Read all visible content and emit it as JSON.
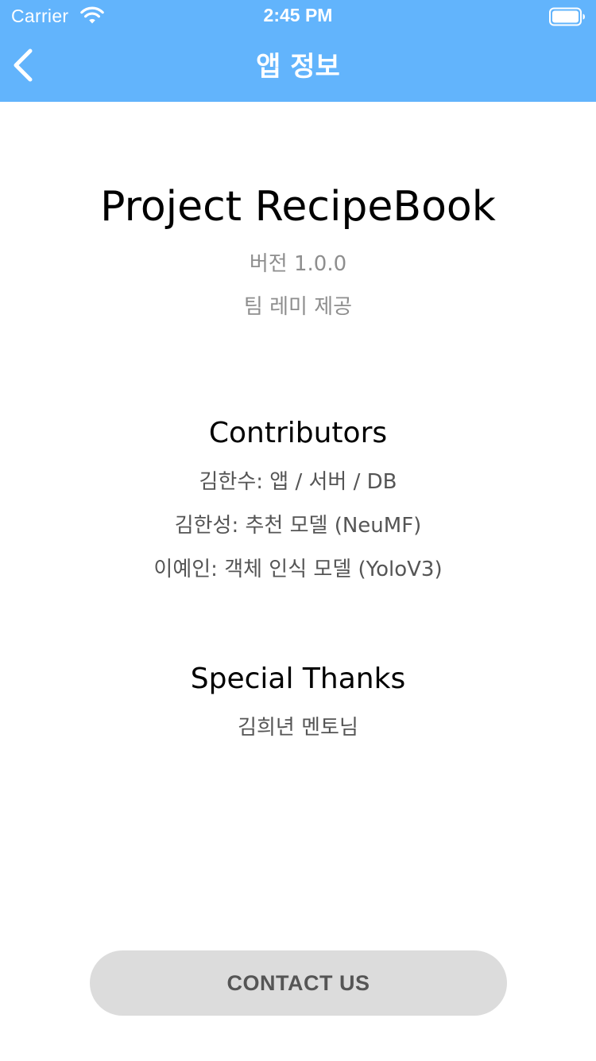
{
  "status_bar": {
    "carrier": "Carrier",
    "time": "2:45 PM",
    "wifi_icon": "wifi-icon",
    "battery_icon": "battery-icon"
  },
  "nav": {
    "title": "앱 정보",
    "back_icon": "chevron-left-icon"
  },
  "app_info": {
    "project_name": "Project RecipeBook",
    "version": "버전 1.0.0",
    "provider": "팀 레미 제공"
  },
  "contributors": {
    "title": "Contributors",
    "items": [
      "김한수: 앱 / 서버 / DB",
      "김한성: 추천 모델 (NeuMF)",
      "이예인: 객체 인식 모델 (YoloV3)"
    ]
  },
  "special_thanks": {
    "title": "Special Thanks",
    "items": [
      "김희년 멘토님"
    ]
  },
  "contact_button": {
    "label": "CONTACT US"
  },
  "colors": {
    "header": "#62b4fc",
    "button": "#dcdcdc",
    "muted_text": "#8e8e8e",
    "body_text": "#555555"
  }
}
